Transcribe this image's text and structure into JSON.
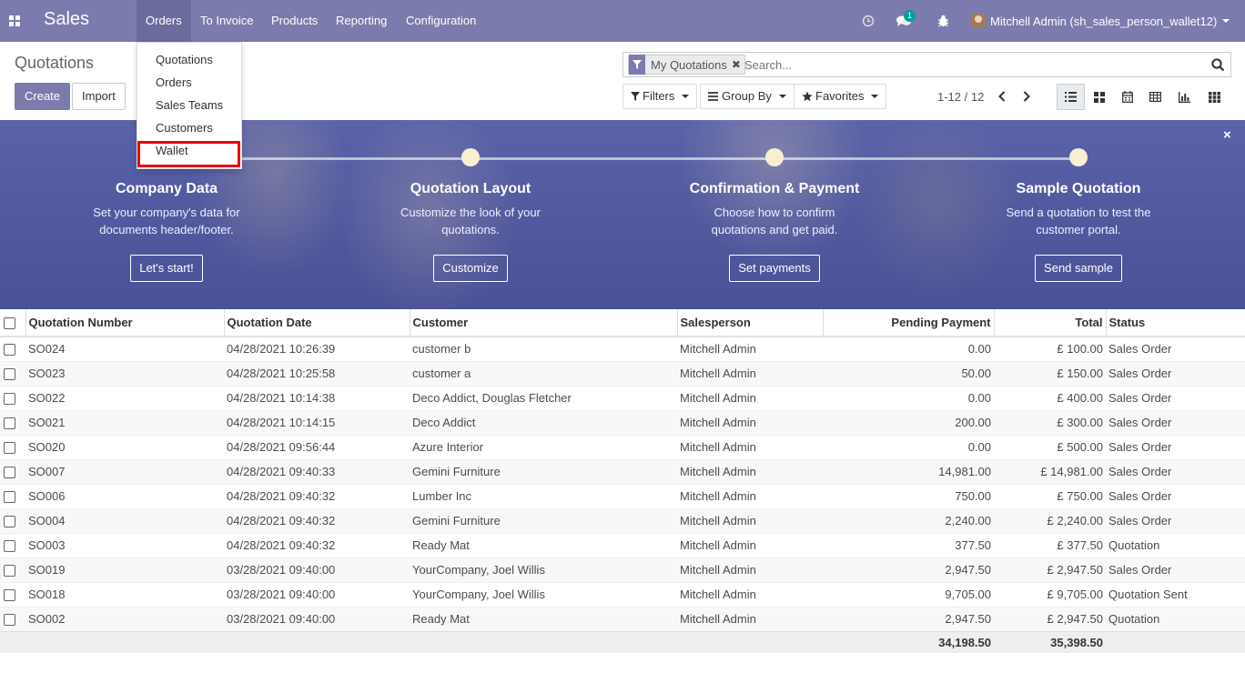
{
  "app": {
    "brand": "Sales"
  },
  "nav": {
    "menus": [
      "Orders",
      "To Invoice",
      "Products",
      "Reporting",
      "Configuration"
    ],
    "active_menu": "Orders",
    "messages_badge": "1",
    "user_label": "Mitchell Admin (sh_sales_person_wallet12)"
  },
  "orders_dropdown": {
    "items": [
      "Quotations",
      "Orders",
      "Sales Teams",
      "Customers",
      "Wallet"
    ],
    "highlighted": "Wallet"
  },
  "control_panel": {
    "title": "Quotations",
    "create_label": "Create",
    "import_label": "Import",
    "search_facet": "My Quotations",
    "search_placeholder": "Search...",
    "filters_label": "Filters",
    "group_by_label": "Group By",
    "favorites_label": "Favorites",
    "pager": "1-12 / 12",
    "views": [
      "list-view-icon",
      "kanban-view-icon",
      "calendar-view-icon",
      "pivot-view-icon",
      "graph-view-icon",
      "grid-view-icon"
    ],
    "active_view": "list-view-icon"
  },
  "banner": {
    "steps": [
      {
        "title": "Company Data",
        "text": "Set your company's data for documents header/footer.",
        "button": "Let's start!"
      },
      {
        "title": "Quotation Layout",
        "text": "Customize the look of your quotations.",
        "button": "Customize"
      },
      {
        "title": "Confirmation & Payment",
        "text": "Choose how to confirm quotations and get paid.",
        "button": "Set payments"
      },
      {
        "title": "Sample Quotation",
        "text": "Send a quotation to test the customer portal.",
        "button": "Send sample"
      }
    ],
    "close_label": "×"
  },
  "table": {
    "columns": [
      "Quotation Number",
      "Quotation Date",
      "Customer",
      "Salesperson",
      "Pending Payment",
      "Total",
      "Status"
    ],
    "rows": [
      [
        "SO024",
        "04/28/2021 10:26:39",
        "customer b",
        "Mitchell Admin",
        "0.00",
        "£ 100.00",
        "Sales Order"
      ],
      [
        "SO023",
        "04/28/2021 10:25:58",
        "customer a",
        "Mitchell Admin",
        "50.00",
        "£ 150.00",
        "Sales Order"
      ],
      [
        "SO022",
        "04/28/2021 10:14:38",
        "Deco Addict, Douglas Fletcher",
        "Mitchell Admin",
        "0.00",
        "£ 400.00",
        "Sales Order"
      ],
      [
        "SO021",
        "04/28/2021 10:14:15",
        "Deco Addict",
        "Mitchell Admin",
        "200.00",
        "£ 300.00",
        "Sales Order"
      ],
      [
        "SO020",
        "04/28/2021 09:56:44",
        "Azure Interior",
        "Mitchell Admin",
        "0.00",
        "£ 500.00",
        "Sales Order"
      ],
      [
        "SO007",
        "04/28/2021 09:40:33",
        "Gemini Furniture",
        "Mitchell Admin",
        "14,981.00",
        "£ 14,981.00",
        "Sales Order"
      ],
      [
        "SO006",
        "04/28/2021 09:40:32",
        "Lumber Inc",
        "Mitchell Admin",
        "750.00",
        "£ 750.00",
        "Sales Order"
      ],
      [
        "SO004",
        "04/28/2021 09:40:32",
        "Gemini Furniture",
        "Mitchell Admin",
        "2,240.00",
        "£ 2,240.00",
        "Sales Order"
      ],
      [
        "SO003",
        "04/28/2021 09:40:32",
        "Ready Mat",
        "Mitchell Admin",
        "377.50",
        "£ 377.50",
        "Quotation"
      ],
      [
        "SO019",
        "03/28/2021 09:40:00",
        "YourCompany, Joel Willis",
        "Mitchell Admin",
        "2,947.50",
        "£ 2,947.50",
        "Sales Order"
      ],
      [
        "SO018",
        "03/28/2021 09:40:00",
        "YourCompany, Joel Willis",
        "Mitchell Admin",
        "9,705.00",
        "£ 9,705.00",
        "Quotation Sent"
      ],
      [
        "SO002",
        "03/28/2021 09:40:00",
        "Ready Mat",
        "Mitchell Admin",
        "2,947.50",
        "£ 2,947.50",
        "Quotation"
      ]
    ],
    "totals": {
      "pending_payment": "34,198.50",
      "total": "35,398.50"
    }
  },
  "colors": {
    "navbar": "#7c7bad",
    "highlight_box": "#ee0000",
    "banner_dot": "#f8efd0"
  }
}
